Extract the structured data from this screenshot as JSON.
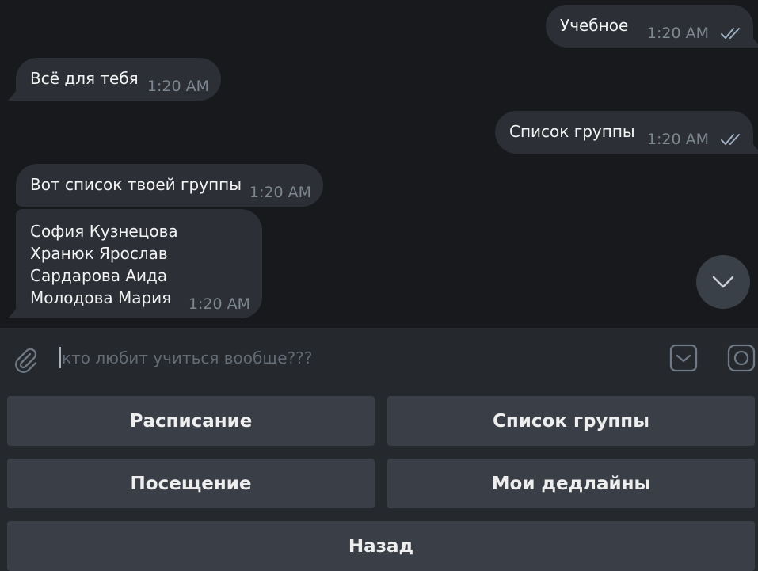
{
  "messages": [
    {
      "id": "m1",
      "direction": "outgoing",
      "text": "Учебное",
      "time": "1:20 AM",
      "read": true
    },
    {
      "id": "m2",
      "direction": "incoming",
      "text": "Всё для тебя",
      "time": "1:20 AM"
    },
    {
      "id": "m3",
      "direction": "outgoing",
      "text": "Список группы",
      "time": "1:20 AM",
      "read": true
    },
    {
      "id": "m4",
      "direction": "incoming",
      "text": "Вот список твоей группы",
      "time": "1:20 AM"
    },
    {
      "id": "m5",
      "direction": "incoming",
      "text": "София Кузнецова\nХранюк Ярослав\nСардарова Аида\nМолодова Мария",
      "time": "1:20 AM"
    }
  ],
  "composer": {
    "placeholder": "кто любит учиться вообще???",
    "value": "",
    "icons": [
      "paperclip-icon",
      "bot-keyboard-icon",
      "camera-icon"
    ]
  },
  "keyboard": {
    "buttons": [
      "Расписание",
      "Список группы",
      "Посещение",
      "Мои дедлайны",
      "Назад"
    ]
  },
  "scroll_down_icon": "chevron-down-icon",
  "colors": {
    "background": "#17191d",
    "bubble": "#2c3036",
    "panel": "#25282d",
    "button": "#3a3f47",
    "time": "#7d8791",
    "checks": "#9fb0c2"
  }
}
